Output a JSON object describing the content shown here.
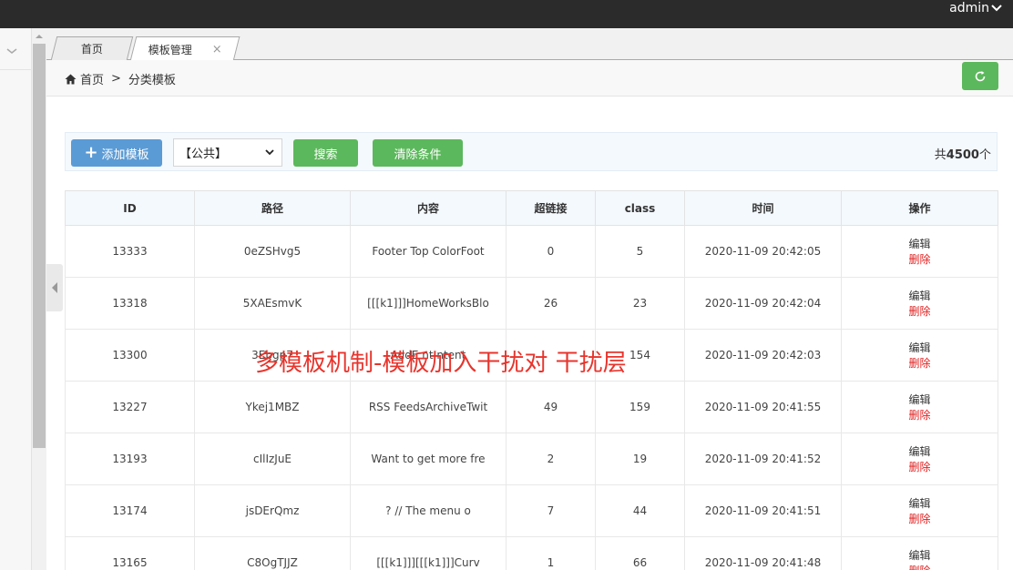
{
  "header": {
    "user": "admin"
  },
  "tabs": [
    {
      "label": "首页",
      "active": false
    },
    {
      "label": "模板管理",
      "active": true,
      "close": "×"
    }
  ],
  "breadcrumb": {
    "home": "首页",
    "sep": ">",
    "current": "分类模板"
  },
  "toolbar": {
    "add_label": "添加模板",
    "add_icon": "+",
    "select_value": "【公共】",
    "search_label": "搜索",
    "clear_label": "清除条件",
    "total_prefix": "共",
    "total_count": "4500",
    "total_suffix": "个"
  },
  "table": {
    "headers": [
      "ID",
      "路径",
      "内容",
      "超链接",
      "class",
      "时间",
      "操作"
    ],
    "rows": [
      {
        "id": "13333",
        "path": "0eZSHvg5",
        "content": "Footer Top ColorFoot",
        "links": "0",
        "cls": "5",
        "time": "2020-11-09 20:42:05"
      },
      {
        "id": "13318",
        "path": "5XAEsmvK",
        "content": "[[[k1]]]HomeWorksBlo",
        "links": "26",
        "cls": "23",
        "time": "2020-11-09 20:42:04"
      },
      {
        "id": "13300",
        "path": "3Ebgp7",
        "content": "AddE  nt ntent",
        "links": "",
        "cls": "154",
        "time": "2020-11-09 20:42:03"
      },
      {
        "id": "13227",
        "path": "Ykej1MBZ",
        "content": "RSS FeedsArchiveTwit",
        "links": "49",
        "cls": "159",
        "time": "2020-11-09 20:41:55"
      },
      {
        "id": "13193",
        "path": "cIlIzJuE",
        "content": "Want to get more fre",
        "links": "2",
        "cls": "19",
        "time": "2020-11-09 20:41:52"
      },
      {
        "id": "13174",
        "path": "jsDErQmz",
        "content": "? // The menu o",
        "links": "7",
        "cls": "44",
        "time": "2020-11-09 20:41:51"
      },
      {
        "id": "13165",
        "path": "C8OgTJJZ",
        "content": "[[[k1]]][[[k1]]]Curv",
        "links": "1",
        "cls": "66",
        "time": "2020-11-09 20:41:48"
      }
    ],
    "edit_label": "编辑",
    "delete_label": "删除"
  },
  "watermark": "多模板机制-模板加入干扰对 干扰层",
  "colors": {
    "topbar": "#2b2b2b",
    "primary": "#5b9bd5",
    "success": "#5cb85c",
    "danger": "#e02020"
  }
}
